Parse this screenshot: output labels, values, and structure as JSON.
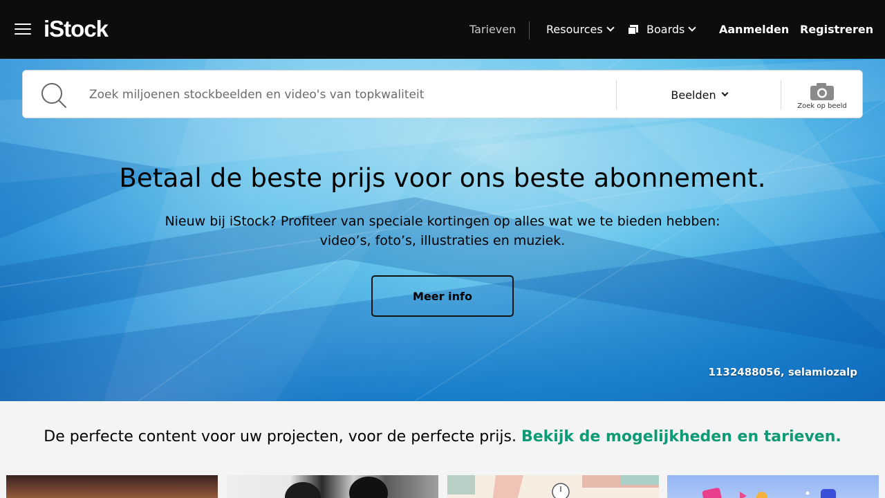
{
  "header": {
    "logo": "iStock",
    "nav": {
      "pricing": "Tarieven",
      "resources": "Resources",
      "boards": "Boards",
      "sign_in": "Aanmelden",
      "register": "Registreren"
    }
  },
  "search": {
    "placeholder": "Zoek miljoenen stockbeelden en video's van topkwaliteit",
    "media_type": "Beelden",
    "image_search_label": "Zoek op beeld"
  },
  "hero": {
    "title": "Betaal de beste prijs voor ons beste abonnement.",
    "subtitle_line1": "Nieuw bij iStock? Profiteer van speciale kortingen op alles wat we te bieden hebben:",
    "subtitle_line2": "video’s, foto’s, illustraties en muziek.",
    "cta": "Meer info",
    "credit": "1132488056, selamiozalp"
  },
  "promo": {
    "text": "De perfecte content voor uw projecten, voor de perfecte prijs.",
    "link": "Bekijk de mogelijkheden en tarieven."
  },
  "colors": {
    "header_bg": "#0c0d0d",
    "link_green": "#0e9a77",
    "hero_blue": "#1c8bd6"
  }
}
